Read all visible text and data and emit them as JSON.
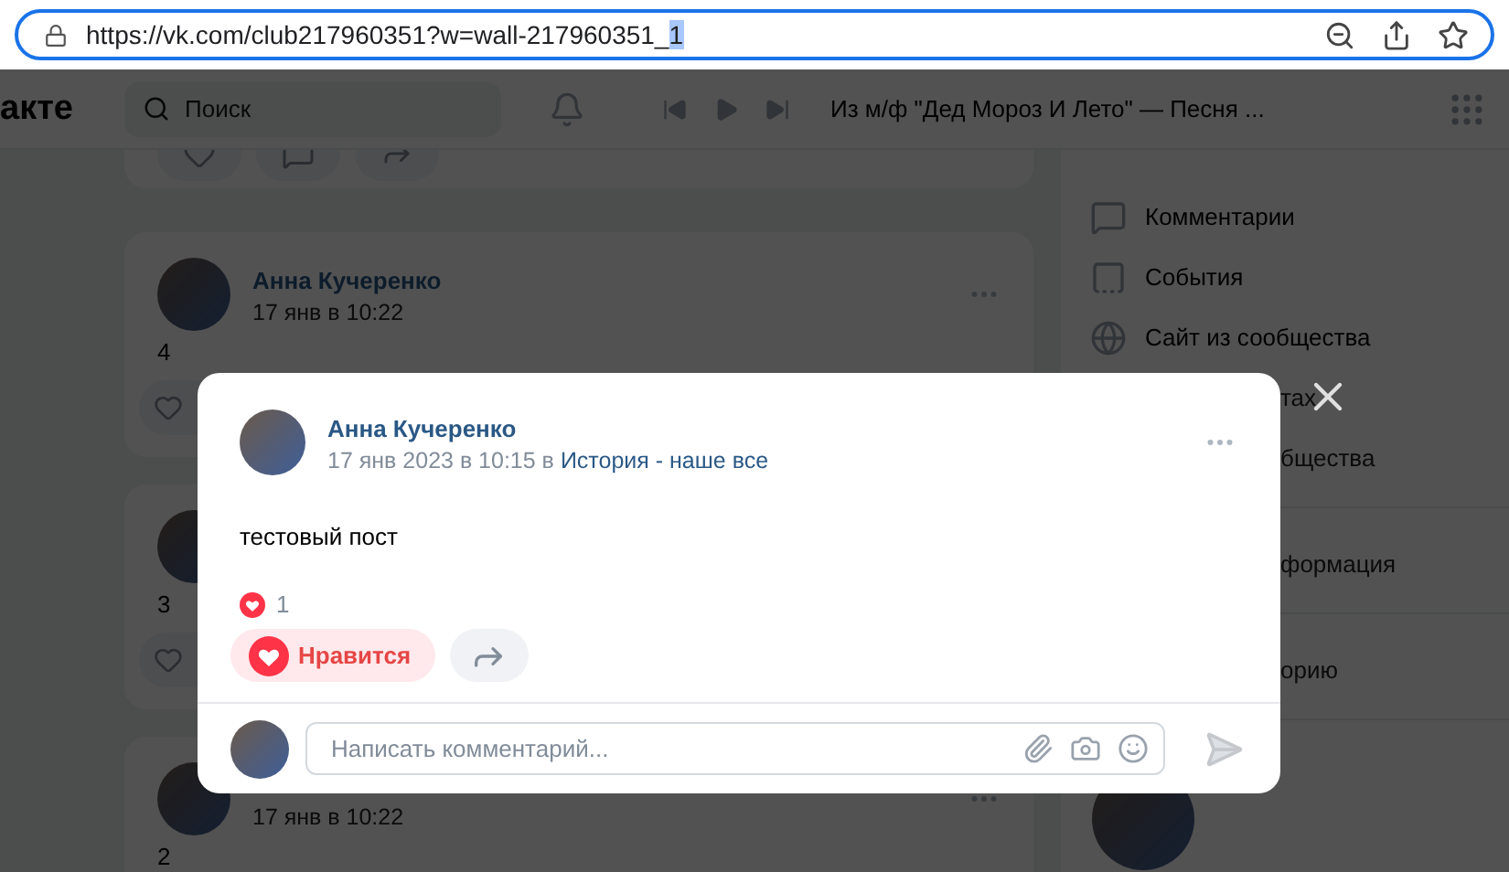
{
  "browser": {
    "url": "https://vk.com/club217960351?w=wall-217960351_",
    "url_selection": "1"
  },
  "header": {
    "logo": "акте",
    "search": {
      "placeholder": "Поиск"
    },
    "track": "Из м/ф \"Дед Мороз И Лето\" — Песня ..."
  },
  "feed": {
    "posts": [
      {
        "author": "Анна Кучеренко",
        "date": "17 янв в 10:22",
        "text": "4"
      },
      {
        "text": "3"
      },
      {
        "date": "17 янв в 10:22",
        "text": "2"
      }
    ]
  },
  "sidebar": {
    "sections": [
      {
        "items": [
          {
            "kind": "comments",
            "label": "Комментарии"
          },
          {
            "kind": "events",
            "label": "События"
          },
          {
            "kind": "website",
            "label": "Сайт из сообщества"
          },
          {
            "kind": "partial",
            "label": "тах"
          },
          {
            "kind": "partial",
            "label": "бщества"
          }
        ]
      },
      {
        "items": [
          {
            "kind": "partial",
            "label": "формация"
          }
        ]
      },
      {
        "items": [
          {
            "kind": "partial",
            "label": "орию"
          }
        ]
      }
    ]
  },
  "modal": {
    "author": "Анна Кучеренко",
    "date": "17 янв 2023 в 10:15 в",
    "group": "История - наше все",
    "text": "тестовый пост",
    "likes": "1",
    "like_button": {
      "label": "Нравится",
      "liked": true
    },
    "comment": {
      "placeholder": "Написать комментарий..."
    }
  }
}
